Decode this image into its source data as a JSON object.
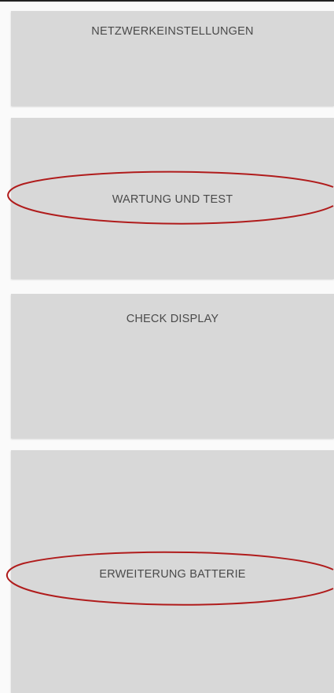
{
  "menu": {
    "items": [
      {
        "label": "NETZWERKEINSTELLUNGEN",
        "highlighted": false
      },
      {
        "label": "WARTUNG UND TEST",
        "highlighted": true
      },
      {
        "label": "CHECK DISPLAY",
        "highlighted": false
      },
      {
        "label": "ERWEITERUNG BATTERIE",
        "highlighted": true
      }
    ]
  },
  "colors": {
    "button_background": "#d8d8d8",
    "page_background": "#fafafa",
    "label_text": "#4a4a4a",
    "highlight_ring": "#b01c1c"
  }
}
